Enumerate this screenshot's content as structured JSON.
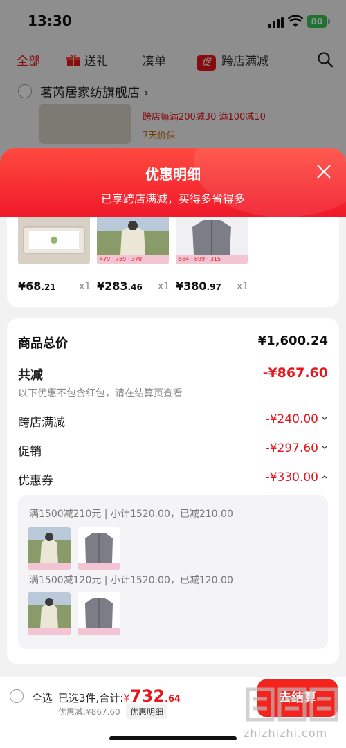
{
  "status_bar": {
    "time": "13:30",
    "battery": "80"
  },
  "category_tabs": [
    {
      "label": "全部",
      "active": true
    },
    {
      "label": "送礼",
      "icon": "gift-icon"
    },
    {
      "label": "凑单"
    },
    {
      "label": "跨店满减",
      "icon_text": "促"
    }
  ],
  "shop": {
    "name": "茗芮居家纺旗舰店",
    "promo": "跨店每满200减30  满100减10",
    "guarantee": "7天价保"
  },
  "sheet": {
    "title": "优惠明细",
    "subtitle": "已享跨店满减，买得多省得多"
  },
  "items": [
    {
      "price_int": "¥68",
      "price_dec": ".21",
      "qty": "x1",
      "image": "tray-product-image",
      "bg": "#d8d0c4"
    },
    {
      "price_int": "¥283",
      "price_dec": ".46",
      "qty": "x1",
      "image": "fleece-jacket-image",
      "bg": "#8a9b6a",
      "tag_prices": [
        "479",
        "759",
        "370"
      ]
    },
    {
      "price_int": "¥380",
      "price_dec": ".97",
      "qty": "x1",
      "image": "gray-jacket-image",
      "bg": "#e9e9ec",
      "tag_prices": [
        "584",
        "899",
        "315"
      ]
    }
  ],
  "summary": {
    "total_label": "商品总价",
    "total_value": "¥1,600.24",
    "reduce_label": "共减",
    "reduce_value": "-¥867.60",
    "note": "以下优惠不包含红包，请在结算页查看",
    "lines": [
      {
        "label": "跨店满减",
        "value": "-¥240.00",
        "chevron": "down"
      },
      {
        "label": "促销",
        "value": "-¥297.60",
        "chevron": "down"
      },
      {
        "label": "优惠券",
        "value": "-¥330.00",
        "chevron": "up"
      }
    ]
  },
  "coupons": [
    {
      "text": "满1500减210元 | 小计1520.00，已减210.00"
    },
    {
      "text": "满1500减120元 | 小计1520.00，已减120.00"
    }
  ],
  "bottom_bar": {
    "select_all": "全选",
    "selected_prefix": "已选3件,合计:",
    "yen": "¥",
    "total_big": "732",
    "total_dec": ".64",
    "discount": "优惠减:¥867.60",
    "detail_chip": "优惠明细",
    "checkout": "去结算"
  },
  "watermark": {
    "text": "zhizhizhi.com"
  },
  "colors": {
    "accent": "#e6161e",
    "header_gradient_top": "#ff4a3f",
    "header_gradient_bottom": "#f0192a"
  }
}
